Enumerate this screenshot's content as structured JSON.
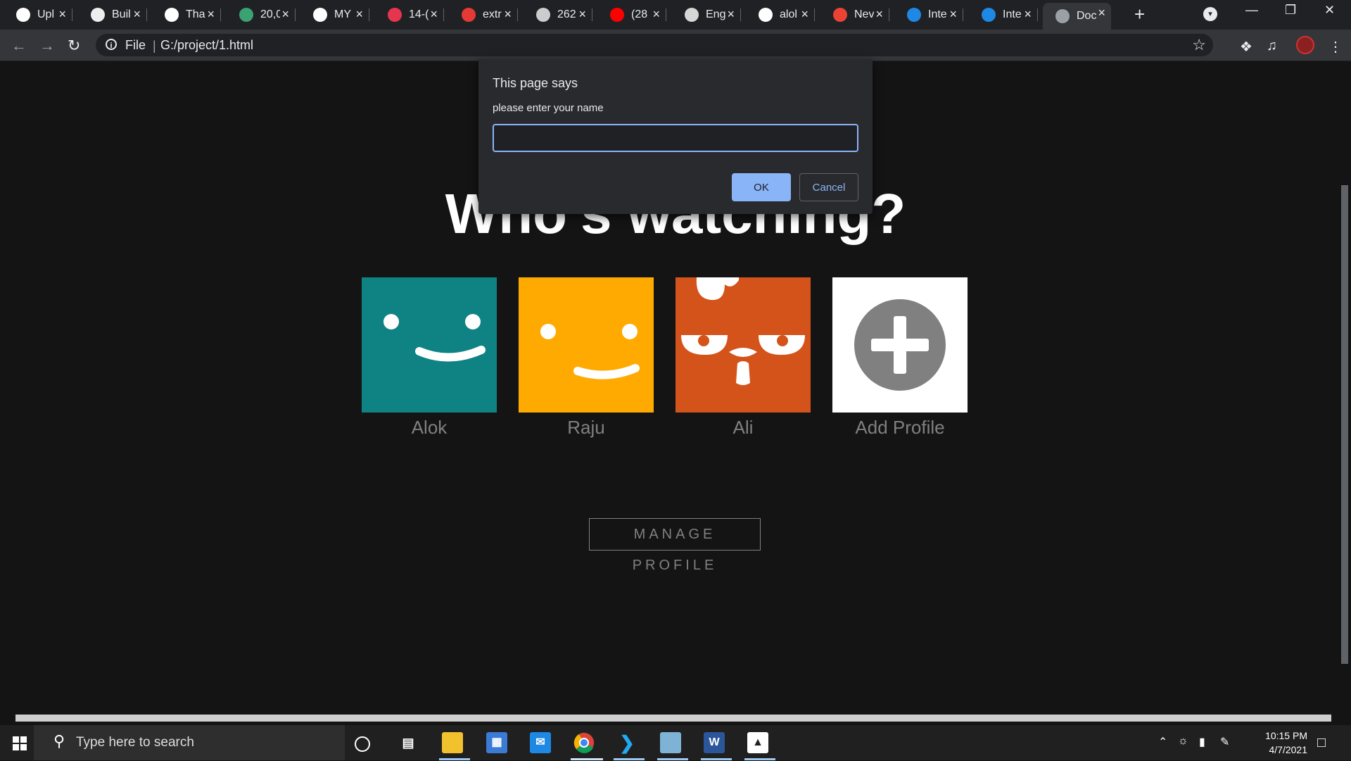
{
  "tabs": [
    {
      "title": "Upl",
      "icon": "github-icon",
      "color": "#ffffff"
    },
    {
      "title": "Buil",
      "icon": "page-icon",
      "color": "#eeeeee"
    },
    {
      "title": "Tha",
      "icon": "globe-icon",
      "color": "#ffffff"
    },
    {
      "title": "20,0",
      "icon": "sheet-icon",
      "color": "#3ba272"
    },
    {
      "title": "MY",
      "icon": "globe-icon",
      "color": "#ffffff"
    },
    {
      "title": "14-(",
      "icon": "udemy-icon",
      "color": "#e8354f"
    },
    {
      "title": "extr",
      "icon": "bookmark-icon",
      "color": "#e53935"
    },
    {
      "title": "262",
      "icon": "gear-icon",
      "color": "#cccccc"
    },
    {
      "title": "(28",
      "icon": "youtube-icon",
      "color": "#ff0000"
    },
    {
      "title": "Eng",
      "icon": "doc-icon",
      "color": "#d6d6d6"
    },
    {
      "title": "alol",
      "icon": "github-icon",
      "color": "#ffffff"
    },
    {
      "title": "Nev",
      "icon": "gmail-icon",
      "color": "#ea4335"
    },
    {
      "title": "Inte",
      "icon": "is-icon",
      "color": "#1e88e5"
    },
    {
      "title": "Inte",
      "icon": "is-icon",
      "color": "#1e88e5"
    },
    {
      "title": "Doc",
      "icon": "globe-icon",
      "color": "#9aa0a6",
      "active": true
    }
  ],
  "address": {
    "protocol": "File",
    "url": "G:/project/1.html"
  },
  "page": {
    "heading": "Who's watching?",
    "profiles": [
      {
        "name": "Alok",
        "kind": "smiley",
        "color": "#0f8383"
      },
      {
        "name": "Raju",
        "kind": "smiley",
        "color": "#ffaa00"
      },
      {
        "name": "Ali",
        "kind": "chicken",
        "color": "#d4531a"
      },
      {
        "name": "Add Profile",
        "kind": "add",
        "color": "#ffffff"
      }
    ],
    "manage_button": "MANAGE PROFILE"
  },
  "dialog": {
    "title": "This page says",
    "message": "please enter your name",
    "input_value": "",
    "ok": "OK",
    "cancel": "Cancel"
  },
  "taskbar": {
    "search_placeholder": "Type here to search",
    "apps": [
      "file-explorer-icon",
      "store-icon",
      "mail-icon",
      "chrome-icon",
      "vscode-icon",
      "notepad-icon",
      "word-icon",
      "photos-icon"
    ],
    "time": "10:15 PM",
    "date": "4/7/2021"
  }
}
